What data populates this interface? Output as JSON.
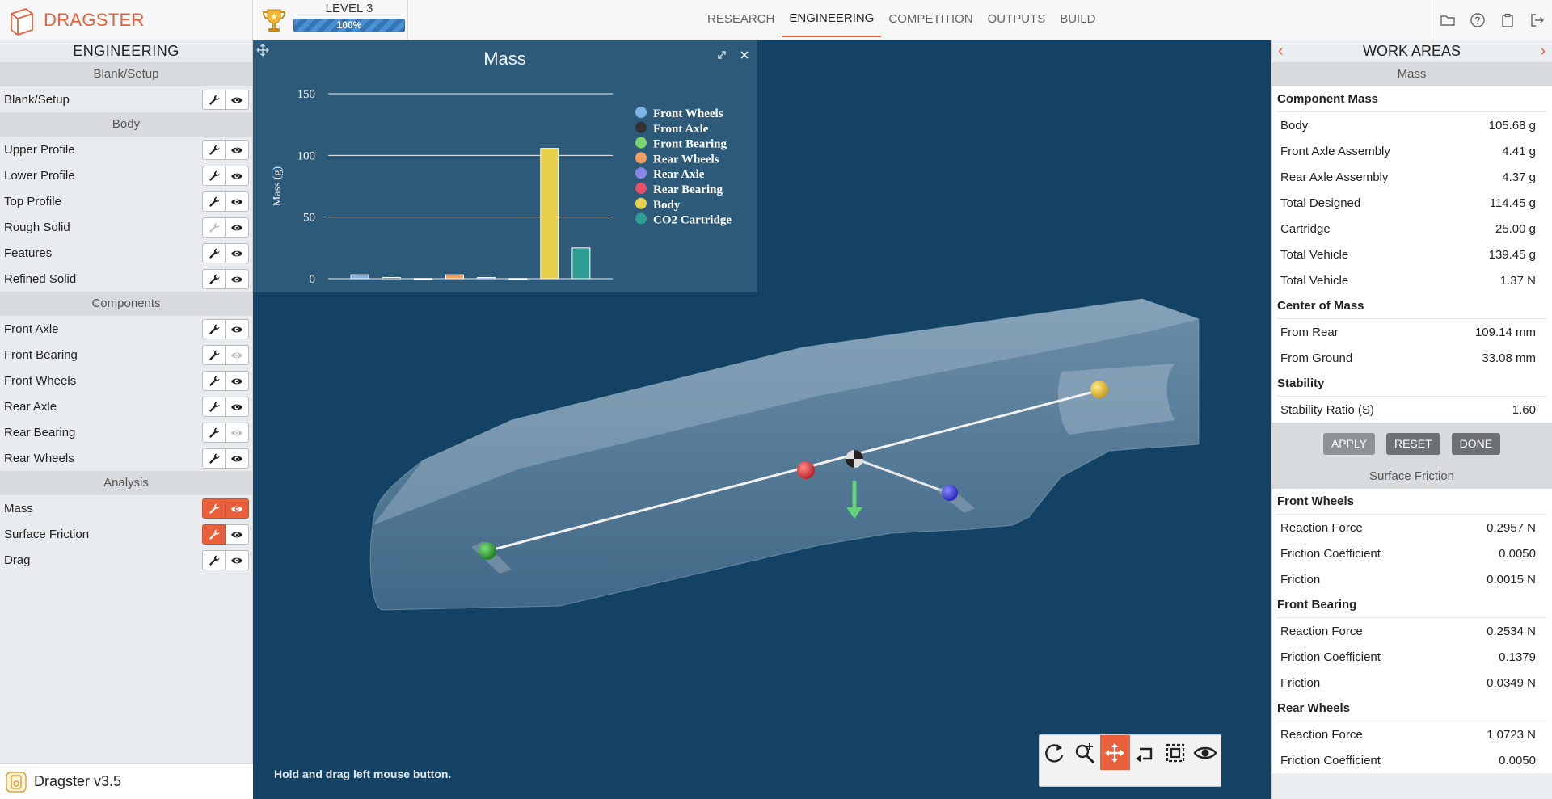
{
  "brand": {
    "name": "DRAGSTER"
  },
  "level": {
    "label": "LEVEL 3",
    "progress_label": "100%",
    "progress": 1.0
  },
  "nav": {
    "tabs": [
      "RESEARCH",
      "ENGINEERING",
      "COMPETITION",
      "OUTPUTS",
      "BUILD"
    ],
    "active": "ENGINEERING"
  },
  "tools": [
    "folder-icon",
    "help-icon",
    "clipboard-icon",
    "logout-icon"
  ],
  "left": {
    "title": "ENGINEERING",
    "sections": [
      {
        "name": "Blank/Setup",
        "items": [
          {
            "label": "Blank/Setup",
            "edit": "normal",
            "view": "normal"
          }
        ]
      },
      {
        "name": "Body",
        "items": [
          {
            "label": "Upper Profile",
            "edit": "normal",
            "view": "normal"
          },
          {
            "label": "Lower Profile",
            "edit": "normal",
            "view": "normal"
          },
          {
            "label": "Top Profile",
            "edit": "normal",
            "view": "normal"
          },
          {
            "label": "Rough Solid",
            "edit": "disabled",
            "view": "normal"
          },
          {
            "label": "Features",
            "edit": "normal",
            "view": "normal"
          },
          {
            "label": "Refined Solid",
            "edit": "normal",
            "view": "normal"
          }
        ]
      },
      {
        "name": "Components",
        "items": [
          {
            "label": "Front Axle",
            "edit": "normal",
            "view": "normal"
          },
          {
            "label": "Front Bearing",
            "edit": "normal",
            "view": "disabled"
          },
          {
            "label": "Front Wheels",
            "edit": "normal",
            "view": "normal"
          },
          {
            "label": "Rear Axle",
            "edit": "normal",
            "view": "normal"
          },
          {
            "label": "Rear Bearing",
            "edit": "normal",
            "view": "disabled"
          },
          {
            "label": "Rear Wheels",
            "edit": "normal",
            "view": "normal"
          }
        ]
      },
      {
        "name": "Analysis",
        "items": [
          {
            "label": "Mass",
            "edit": "active",
            "view": "active"
          },
          {
            "label": "Surface Friction",
            "edit": "active",
            "view": "normal"
          },
          {
            "label": "Drag",
            "edit": "normal",
            "view": "normal"
          }
        ]
      }
    ],
    "version": "Dragster v3.5"
  },
  "viewport": {
    "hint": "Hold and drag left mouse button."
  },
  "chart_data": {
    "type": "bar",
    "title": "Mass",
    "ylabel": "Mass (g)",
    "xlabel": "",
    "ylim": [
      0,
      150
    ],
    "yticks": [
      0,
      50,
      100,
      150
    ],
    "categories": [
      "Front Wheels",
      "Front Axle",
      "Front Bearing",
      "Rear Wheels",
      "Rear Axle",
      "Rear Bearing",
      "Body",
      "CO2 Cartridge"
    ],
    "values": [
      3.2,
      1.0,
      0.2,
      3.2,
      1.0,
      0.2,
      105.68,
      25.0
    ],
    "colors": [
      "#7fb4e8",
      "#333333",
      "#7bd46c",
      "#f1a060",
      "#8a87e6",
      "#e8506a",
      "#e8d04a",
      "#2e9e94"
    ],
    "legend_position": "right",
    "grid": true
  },
  "right": {
    "title": "WORK AREAS",
    "mass": {
      "section": "Mass",
      "groups": [
        {
          "name": "Component Mass",
          "rows": [
            {
              "k": "Body",
              "v": "105.68 g"
            },
            {
              "k": "Front Axle Assembly",
              "v": "4.41 g"
            },
            {
              "k": "Rear Axle Assembly",
              "v": "4.37 g"
            },
            {
              "k": "Total Designed",
              "v": "114.45 g"
            },
            {
              "k": "Cartridge",
              "v": "25.00 g"
            },
            {
              "k": "Total Vehicle",
              "v": "139.45 g"
            },
            {
              "k": "Total Vehicle",
              "v": "1.37 N"
            }
          ]
        },
        {
          "name": "Center of Mass",
          "rows": [
            {
              "k": "From Rear",
              "v": "109.14 mm"
            },
            {
              "k": "From Ground",
              "v": "33.08 mm"
            }
          ]
        },
        {
          "name": "Stability",
          "rows": [
            {
              "k": "Stability Ratio (S)",
              "v": "1.60"
            }
          ]
        }
      ],
      "actions": [
        "APPLY",
        "RESET",
        "DONE"
      ]
    },
    "friction": {
      "section": "Surface Friction",
      "groups": [
        {
          "name": "Front Wheels",
          "rows": [
            {
              "k": "Reaction Force",
              "v": "0.2957 N"
            },
            {
              "k": "Friction Coefficient",
              "v": "0.0050"
            },
            {
              "k": "Friction",
              "v": "0.0015 N"
            }
          ]
        },
        {
          "name": "Front Bearing",
          "rows": [
            {
              "k": "Reaction Force",
              "v": "0.2534 N"
            },
            {
              "k": "Friction Coefficient",
              "v": "0.1379"
            },
            {
              "k": "Friction",
              "v": "0.0349 N"
            }
          ]
        },
        {
          "name": "Rear Wheels",
          "rows": [
            {
              "k": "Reaction Force",
              "v": "1.0723 N"
            },
            {
              "k": "Friction Coefficient",
              "v": "0.0050"
            }
          ]
        }
      ]
    }
  }
}
